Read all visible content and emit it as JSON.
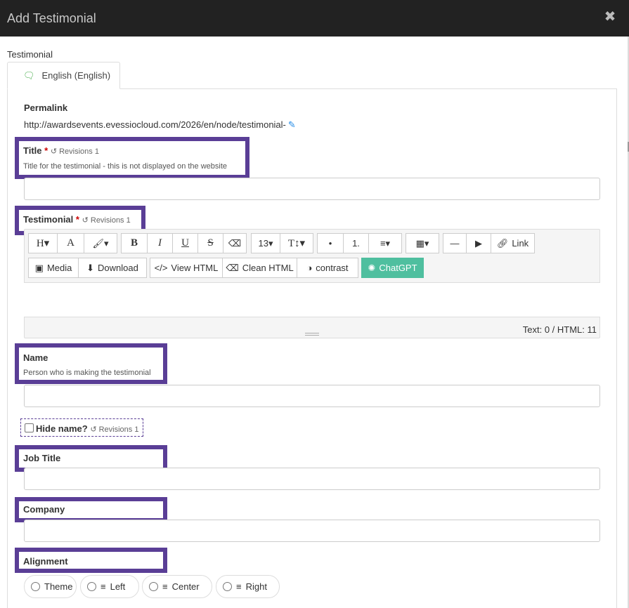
{
  "dialog": {
    "title": "Add Testimonial",
    "close_glyph": "✖"
  },
  "section_label": "Testimonial",
  "tab": {
    "label": "English (English)",
    "icon": "speech-bubble-icon"
  },
  "permalink": {
    "label": "Permalink",
    "url": "http://awardsevents.evessiocloud.com/2026/en/node/testimonial-",
    "edit_icon": "pencil-icon"
  },
  "fields": {
    "title": {
      "label": "Title",
      "required": "*",
      "revisions": "Revisions 1",
      "help": "Title for the testimonial - this is not displayed on the website",
      "value": ""
    },
    "testimonial": {
      "label": "Testimonial",
      "required": "*",
      "revisions": "Revisions 1"
    },
    "name": {
      "label": "Name",
      "help": "Person who is making the testimonial",
      "value": ""
    },
    "hide_name": {
      "label": "Hide name?",
      "revisions": "Revisions 1",
      "checked": false
    },
    "job_title": {
      "label": "Job Title",
      "value": ""
    },
    "company": {
      "label": "Company",
      "value": ""
    },
    "alignment": {
      "label": "Alignment",
      "options": [
        "Theme",
        "Left",
        "Center",
        "Right"
      ]
    }
  },
  "editor": {
    "toolbar_row1": [
      "H▾",
      "A",
      "🖌▾",
      "B",
      "I",
      "U",
      "S",
      "⌫",
      "13▾",
      "T↕▾",
      "•",
      "1.",
      "≡▾",
      "▦▾",
      "—",
      "▶",
      "Link"
    ],
    "toolbar_row2": [
      "Media",
      "Download",
      "View HTML",
      "Clean HTML",
      "contrast",
      "ChatGPT"
    ],
    "status": "Text: 0 / HTML: 11"
  },
  "colors": {
    "header_bg": "#222222",
    "highlight": "#5a3e96",
    "chatgpt": "#4fbf9f",
    "link_icon": "#1e88e5"
  }
}
